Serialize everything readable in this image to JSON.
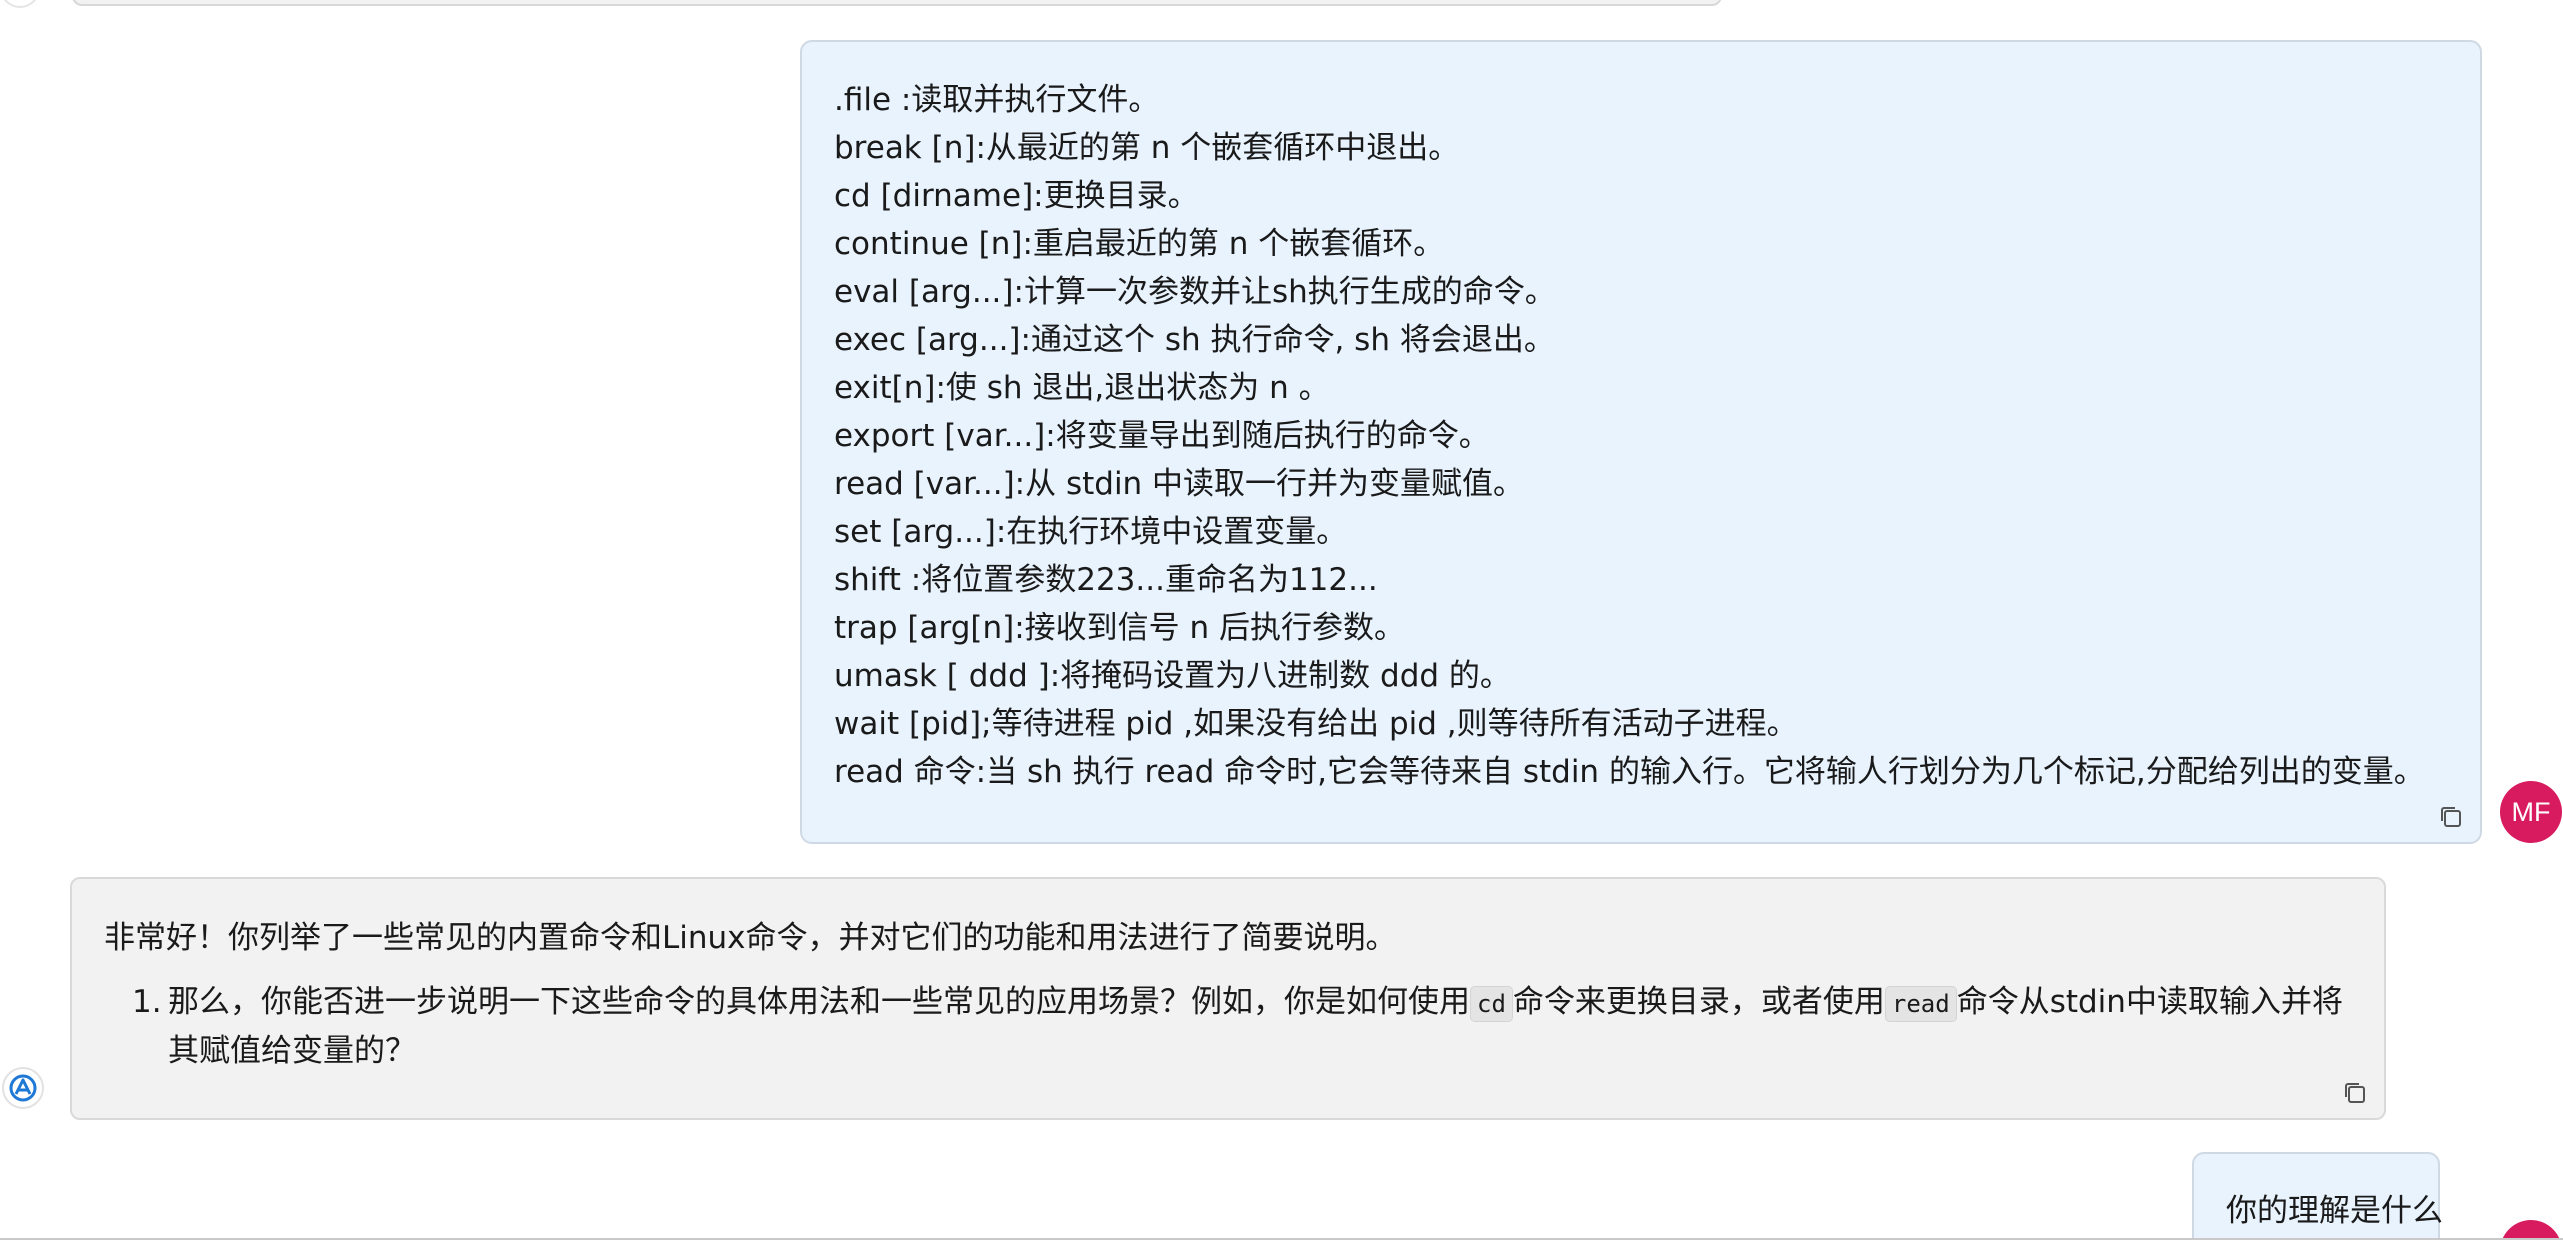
{
  "colors": {
    "user_bubble_bg": "#e8f3fe",
    "assistant_bubble_bg": "#f2f2f2",
    "avatar_bg": "#d81b5e"
  },
  "user_message": {
    "lines": [
      ".file :读取并执行文件。",
      "break [n]:从最近的第 n 个嵌套循环中退出。",
      "cd [dirname]:更换目录。",
      "continue [n]:重启最近的第 n 个嵌套循环。",
      "eval [arg...]:计算一次参数并让sh执行生成的命令。",
      "exec [arg...]:通过这个 sh 执行命令, sh 将会退出。",
      "exit[n]:使 sh 退出,退出状态为 n 。",
      "export [var...]:将变量导出到随后执行的命令。",
      "read [var...]:从 stdin 中读取一行并为变量赋值。",
      "set [arg...]:在执行环境中设置变量。",
      "shift :将位置参数223...重命名为112...",
      "trap [arg[n]:接收到信号 n 后执行参数。",
      "umask [ ddd ]:将掩码设置为八进制数 ddd 的。",
      "wait [pid];等待进程 pid ,如果没有给出 pid ,则等待所有活动子进程。",
      "read 命令:当 sh 执行 read 命令时,它会等待来自 stdin 的输入行。它将输人行划分为几个标记,分配给列出的变量。"
    ],
    "copy_icon": "copy-icon"
  },
  "user_avatar": {
    "initials": "MF"
  },
  "assistant_message": {
    "intro": "非常好！你列举了一些常见的内置命令和Linux命令，并对它们的功能和用法进行了简要说明。",
    "list": [
      {
        "number": "1.",
        "part1": "那么，你能否进一步说明一下这些命令的具体用法和一些常见的应用场景？例如，你是如何使用",
        "code1": "cd",
        "part2": "命令来更换目录，或者使用",
        "code2": "read",
        "part3": "命令从stdin中读取输入并将其赋值给变量的？"
      }
    ],
    "copy_icon": "copy-icon",
    "logo_icon": "assistant-logo-icon"
  },
  "next_user_message": {
    "text": "你的理解是什么"
  }
}
